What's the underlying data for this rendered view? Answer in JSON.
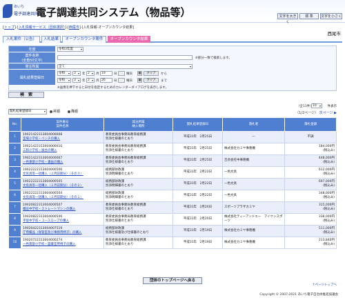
{
  "logo": {
    "line1": "あいち",
    "line2": "電子調達共同"
  },
  "header": {
    "title": "電子調達共同システム（物品等）"
  },
  "font_size": {
    "larger": "文字を大きく",
    "standard": "標 準",
    "smaller": "文字を小さく"
  },
  "breadcrumb": {
    "top": "トップ",
    "procurement": "入札情報サービス（団体選択）",
    "city": "西尾市",
    "current": "入札情報-オープンカウンタ結果"
  },
  "city_name": "西尾市",
  "tabs": [
    "入札案件（公告）",
    "入札結果",
    "オープンカウンタ案件",
    "オープンカウンタ結果"
  ],
  "form": {
    "year_label": "年度",
    "year_value": "令和3年度",
    "name_label": "案件名称",
    "name_sub": "(全角50文字)",
    "name_value": "",
    "name_note": "※部分一致で検索します。",
    "org_label": "発注所属",
    "org_value": "全て",
    "date_label": "開札結果登録日",
    "from": {
      "era": "令和",
      "year": "3",
      "month": "2",
      "day": "19",
      "weekday_label": "曜日",
      "clear": "クリア",
      "suffix": "から"
    },
    "to": {
      "era": "令和",
      "year": "3",
      "month": "2",
      "day": "26",
      "weekday_label": "曜日",
      "clear": "クリア",
      "suffix": "まで"
    },
    "note": "※画像を押下すると日付を指定するためのカレンダーダイアログを表示します。"
  },
  "search_btn": "検　索",
  "sort": {
    "select": "開札結果登録日",
    "asc": "昇順",
    "desc": "降順"
  },
  "paging": {
    "total": "（全11件）",
    "per_page": "10",
    "per_page_label": "件表示",
    "page": "（1/2ページ）",
    "next": "次ページ ▶"
  },
  "table": {
    "headers": [
      "No.",
      "案件番号\n案件名称",
      "発注所属\n納入場所",
      "開札結果登録日",
      "落札者",
      "落札金額"
    ],
    "rows": [
      {
        "no": "1",
        "id": "19021422313004000008",
        "name": "室場小学校・ベンチの購入",
        "org": "教育委員会事務局教育総務課",
        "place": "別添仕様書のとおり",
        "date": "平成31年　2月25日",
        "winner": "---",
        "amount": "不調",
        "tax": ""
      },
      {
        "no": "2",
        "id": "19021422313004000010",
        "name": "三和小学校・展台の購入",
        "org": "教育委員会事務局教育総務課",
        "place": "別添仕様書のとおり",
        "date": "平成31年　2月25日",
        "winner": "株式会社カミヤ事務機",
        "amount": "184,000円",
        "tax": "(税込み)"
      },
      {
        "no": "3",
        "id": "19021422313004000067",
        "name": "一色東部小学校・書画の購入",
        "org": "教育委員会事務局教育総務課",
        "place": "別添仕様書のとおり",
        "date": "平成31年　2月25日",
        "winner": "吉貞会社中事務機",
        "amount": "448,000円",
        "tax": "(税込み)"
      },
      {
        "no": "4",
        "id": "19022222313004000506",
        "name": "文房具等一括購入（２月前期分）（その３）",
        "org": "総務部財政課",
        "place": "別添明細書のとおり",
        "date": "平成31年　2月22日",
        "winner": "一色文具",
        "amount": "612,000円",
        "tax": "(税込み)"
      },
      {
        "no": "5",
        "id": "19022222313004000505",
        "name": "文房具等一括購入（２月前期分）（その２）",
        "org": "総務部財政課",
        "place": "別添明細書のとおり",
        "date": "平成31年　2月22日",
        "winner": "一色文具",
        "amount": "697,000円",
        "tax": "(税込み)"
      },
      {
        "no": "6",
        "id": "19022222313004000504",
        "name": "文房具等一括購入（２月前期分）（その１）",
        "org": "総務部財政課",
        "place": "別添明細書のとおり",
        "date": "平成31年　2月22日",
        "winner": "一色文具",
        "amount": "348,000円",
        "tax": "(税込み)"
      },
      {
        "no": "7",
        "id": "19020822313004000507",
        "name": "幡豆中学校・ストレートマシンの購入",
        "org": "教育委員会事務局教育総務課",
        "place": "別添仕様書のとおり",
        "date": "平成31年　2月20日",
        "winner": "スポーツプラザカミヤ",
        "amount": "315,000円",
        "tax": "(税込み)"
      },
      {
        "no": "8",
        "id": "19020822313004000506",
        "name": "平坂中学校・コースロープの購入",
        "org": "教育委員会事務局教育総務課",
        "place": "別添仕様書のとおり",
        "date": "平成31年　2月20日",
        "winner": "株式会社ティーアンドエー　アイケンスポーツ",
        "amount": "338,000円",
        "tax": "(税込み)"
      },
      {
        "no": "9",
        "id": "19020422313004007519",
        "name": "庁用備品（保管室及び事務用椅子）の購入",
        "org": "総務部財政課",
        "place": "別添仕様書及び仕様書のとおり",
        "date": "平成31年　2月19日",
        "winner": "株式会社カミヤ事務機",
        "amount": "511,000円",
        "tax": "(税込み)"
      },
      {
        "no": "10",
        "id": "19020722313004000274",
        "name": "一色南部小学校・図書室用椅子の購入",
        "org": "教育委員会事務局教育総務課",
        "place": "別添仕様書のとおり",
        "date": "平成31年　2月19日",
        "winner": "株式会社カミヤ事務機",
        "amount": "213,840円",
        "tax": "(税込み)"
      }
    ]
  },
  "back_btn": "団体のトップページへ戻る",
  "page_top": "↑ページトップへ",
  "footer": "Copyright © 2007-2021 あいち電子自治体推進協議会"
}
